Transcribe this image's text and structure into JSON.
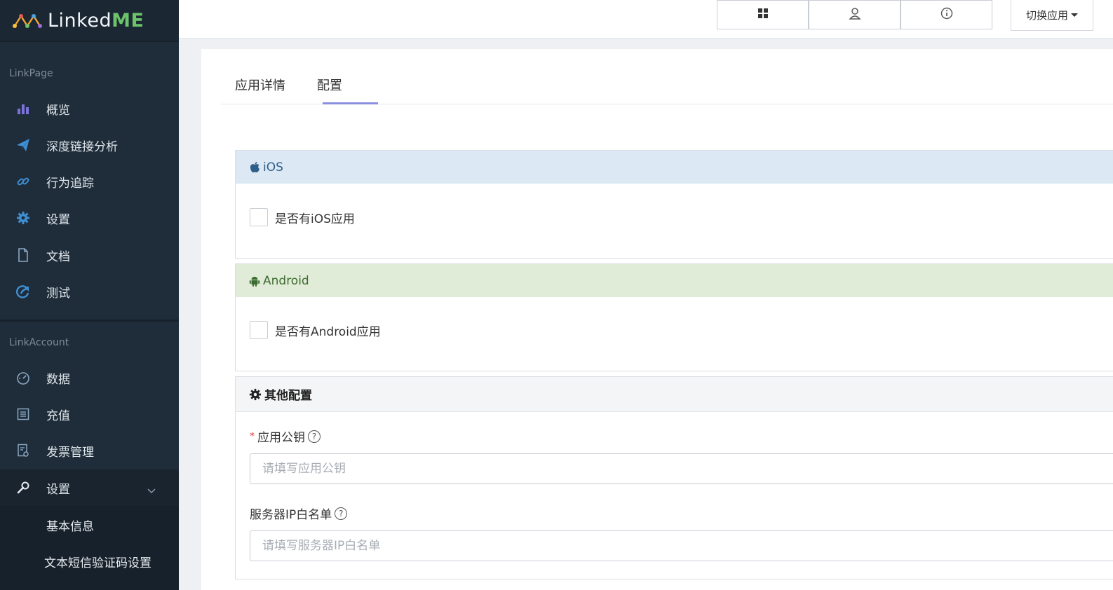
{
  "brand": {
    "name_prefix": "Linked",
    "name_suffix": "ME"
  },
  "sidebar": {
    "section_linkpage": "LinkPage",
    "linkpage_items": [
      {
        "label": "概览",
        "icon": "bar-chart-icon"
      },
      {
        "label": "深度链接分析",
        "icon": "paper-plane-icon"
      },
      {
        "label": "行为追踪",
        "icon": "link-icon"
      },
      {
        "label": "设置",
        "icon": "gear-icon"
      },
      {
        "label": "文档",
        "icon": "document-icon"
      },
      {
        "label": "测试",
        "icon": "share-icon"
      }
    ],
    "section_linkaccount": "LinkAccount",
    "linkaccount_items": [
      {
        "label": "数据",
        "icon": "dashboard-icon"
      },
      {
        "label": "充值",
        "icon": "list-icon"
      },
      {
        "label": "发票管理",
        "icon": "invoice-icon"
      },
      {
        "label": "设置",
        "icon": "wrench-icon"
      }
    ],
    "sub_items": [
      "基本信息",
      "文本短信验证码设置"
    ]
  },
  "topbar": {
    "icons": [
      "grid-icon",
      "user-icon",
      "info-icon"
    ],
    "switch_app": "切换应用"
  },
  "tabs": [
    {
      "label": "应用详情",
      "active": false
    },
    {
      "label": "配置",
      "active": true
    }
  ],
  "ios_panel": {
    "title": "iOS",
    "checkbox_label": "是否有iOS应用",
    "checked": false,
    "header_color": "#dce9f4"
  },
  "android_panel": {
    "title": "Android",
    "checkbox_label": "是否有Android应用",
    "checked": false,
    "header_color": "#e1ecd8"
  },
  "other_panel": {
    "title": "其他配置",
    "public_key_label": "应用公钥",
    "public_key_required_mark": "*",
    "public_key_placeholder": "请填写应用公钥",
    "ip_whitelist_label": "服务器IP白名单",
    "ip_whitelist_placeholder": "请填写服务器IP白名单",
    "help_mark": "?"
  }
}
